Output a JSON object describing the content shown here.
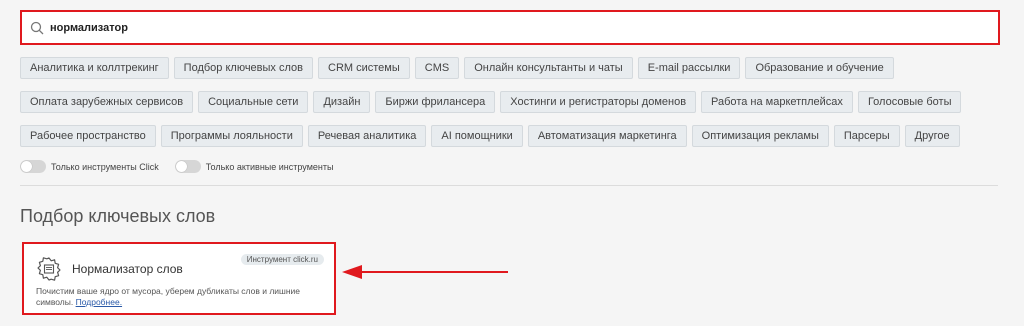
{
  "search": {
    "value": "нормализатор",
    "placeholder": ""
  },
  "categories": {
    "row1": [
      "Аналитика и коллтрекинг",
      "Подбор ключевых слов",
      "CRM системы",
      "CMS",
      "Онлайн консультанты и чаты",
      "E-mail рассылки",
      "Образование и обучение"
    ],
    "row2": [
      "Оплата зарубежных сервисов",
      "Социальные сети",
      "Дизайн",
      "Биржи фрилансера",
      "Хостинги и регистраторы доменов",
      "Работа на маркетплейсах",
      "Голосовые боты"
    ],
    "row3": [
      "Рабочее пространство",
      "Программы лояльности",
      "Речевая аналитика",
      "AI помощники",
      "Автоматизация маркетинга",
      "Оптимизация рекламы",
      "Парсеры",
      "Другое"
    ]
  },
  "toggles": {
    "click_only": "Только инструменты Click",
    "active_only": "Только активные инструменты"
  },
  "section": {
    "title": "Подбор ключевых слов"
  },
  "card": {
    "title": "Нормализатор слов",
    "badge": "Инструмент click.ru",
    "description": "Почистим ваше ядро от мусора, уберем дубликаты слов и лишние символы.",
    "link": "Подробнее."
  },
  "colors": {
    "highlight": "#e0191e",
    "tag_bg": "#e8ecef",
    "link": "#2a5aa8"
  }
}
